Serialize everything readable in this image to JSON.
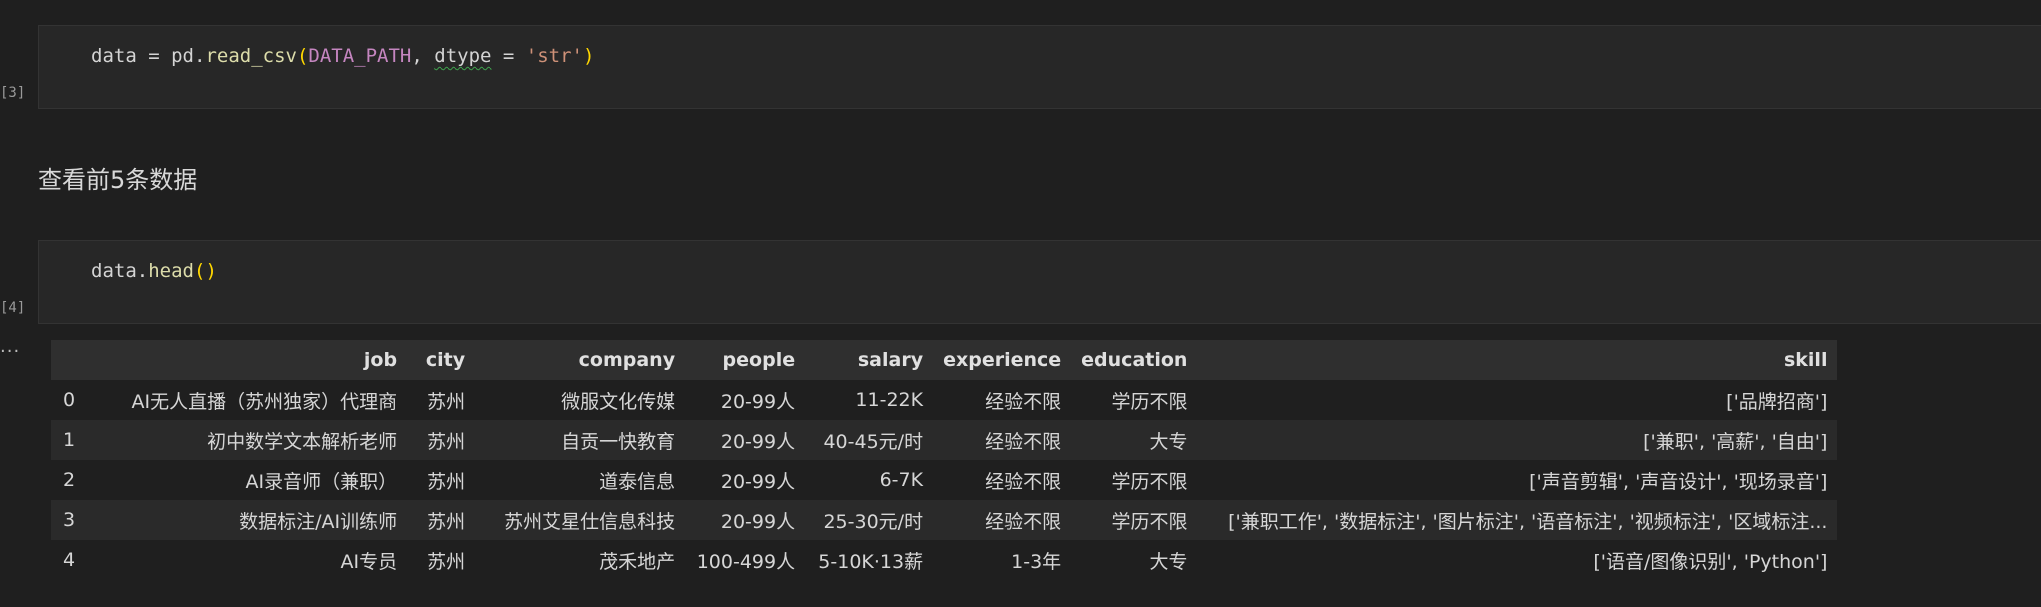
{
  "cells": [
    {
      "exec_count": "[3]",
      "code": {
        "var": "data",
        "assign": " = ",
        "obj": "pd",
        "dot": ".",
        "func": "read_csv",
        "open": "(",
        "arg1": "DATA_PATH",
        "comma": ", ",
        "kw": "dtype",
        "eq": " = ",
        "str": "'str'",
        "close": ")"
      }
    },
    {
      "exec_count": "[4]",
      "code": {
        "var": "data",
        "dot": ".",
        "func": "head",
        "open": "(",
        "close": ")"
      }
    }
  ],
  "markdown": {
    "heading": "查看前5条数据"
  },
  "output": {
    "dots": "...",
    "columns": [
      "",
      "job",
      "city",
      "company",
      "people",
      "salary",
      "experience",
      "education",
      "skill"
    ],
    "rows": [
      [
        "0",
        "AI无人直播（苏州独家）代理商",
        "苏州",
        "微服文化传媒",
        "20-99人",
        "11-22K",
        "经验不限",
        "学历不限",
        "['品牌招商']"
      ],
      [
        "1",
        "初中数学文本解析老师",
        "苏州",
        "自贡一快教育",
        "20-99人",
        "40-45元/时",
        "经验不限",
        "大专",
        "['兼职', '高薪', '自由']"
      ],
      [
        "2",
        "AI录音师（兼职）",
        "苏州",
        "道泰信息",
        "20-99人",
        "6-7K",
        "经验不限",
        "学历不限",
        "['声音剪辑', '声音设计', '现场录音']"
      ],
      [
        "3",
        "数据标注/AI训练师",
        "苏州",
        "苏州艾星仕信息科技",
        "20-99人",
        "25-30元/时",
        "经验不限",
        "学历不限",
        "['兼职工作', '数据标注', '图片标注', '语音标注', '视频标注', '区域标注..."
      ],
      [
        "4",
        "AI专员",
        "苏州",
        "茂禾地产",
        "100-499人",
        "5-10K·13薪",
        "1-3年",
        "大专",
        "['语音/图像识别', 'Python']"
      ]
    ]
  }
}
